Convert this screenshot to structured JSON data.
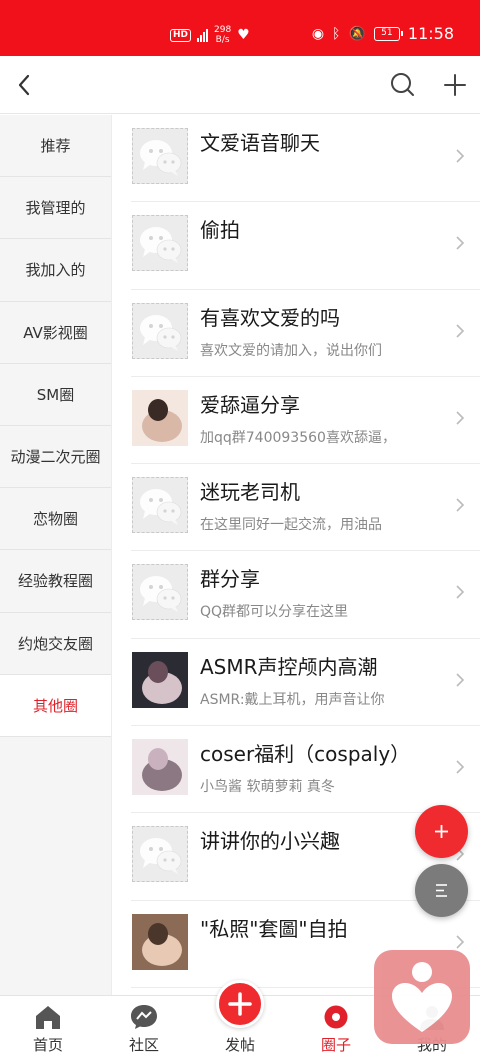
{
  "status_bar": {
    "hd": "HD",
    "speed_top": "298",
    "speed_bottom": "B/s",
    "battery": "51",
    "time": "11:58"
  },
  "header": {
    "back_icon": "chevron-left-icon",
    "search_icon": "search-icon",
    "add_icon": "plus-icon"
  },
  "sidebar": {
    "items": [
      {
        "label": "推荐"
      },
      {
        "label": "我管理的"
      },
      {
        "label": "我加入的"
      },
      {
        "label": "AV影视圈"
      },
      {
        "label": "SM圈"
      },
      {
        "label": "动漫二次元圈"
      },
      {
        "label": "恋物圈"
      },
      {
        "label": "经验教程圈"
      },
      {
        "label": "约炮交友圈"
      },
      {
        "label": "其他圈"
      }
    ],
    "active_index": 9
  },
  "circles": [
    {
      "title": "文爱语音聊天",
      "desc": "",
      "thumb": "wechat-placeholder"
    },
    {
      "title": "偷拍",
      "desc": "",
      "thumb": "wechat-placeholder"
    },
    {
      "title": "有喜欢文爱的吗",
      "desc": "喜欢文爱的请加入，说出你们",
      "thumb": "wechat-placeholder"
    },
    {
      "title": "爱舔逼分享",
      "desc": "加qq群740093560喜欢舔逼，",
      "thumb": "photo"
    },
    {
      "title": "迷玩老司机",
      "desc": "在这里同好一起交流，用油品",
      "thumb": "wechat-placeholder"
    },
    {
      "title": "群分享",
      "desc": "QQ群都可以分享在这里",
      "thumb": "wechat-placeholder"
    },
    {
      "title": "ASMR声控颅内高潮",
      "desc": "ASMR:戴上耳机，用声音让你",
      "thumb": "photo"
    },
    {
      "title": "coser福利（cospaly）",
      "desc": "小鸟酱 软萌萝莉 真冬",
      "thumb": "photo"
    },
    {
      "title": "讲讲你的小兴趣",
      "desc": "",
      "thumb": "wechat-placeholder"
    },
    {
      "title": "\"私照\"套圖\"自拍",
      "desc": "",
      "thumb": "photo"
    }
  ],
  "bottom_nav": {
    "items": [
      {
        "label": "首页",
        "icon": "home-icon"
      },
      {
        "label": "社区",
        "icon": "community-icon"
      },
      {
        "label": "发帖",
        "icon": "post-plus-icon"
      },
      {
        "label": "圈子",
        "icon": "circle-icon"
      },
      {
        "label": "我的",
        "icon": "profile-icon"
      }
    ],
    "active_index": 3
  },
  "colors": {
    "brand": "#f0111a",
    "accent": "#e0202a",
    "fab_add": "#ef2b30",
    "fab_menu": "#7b7b7b"
  }
}
